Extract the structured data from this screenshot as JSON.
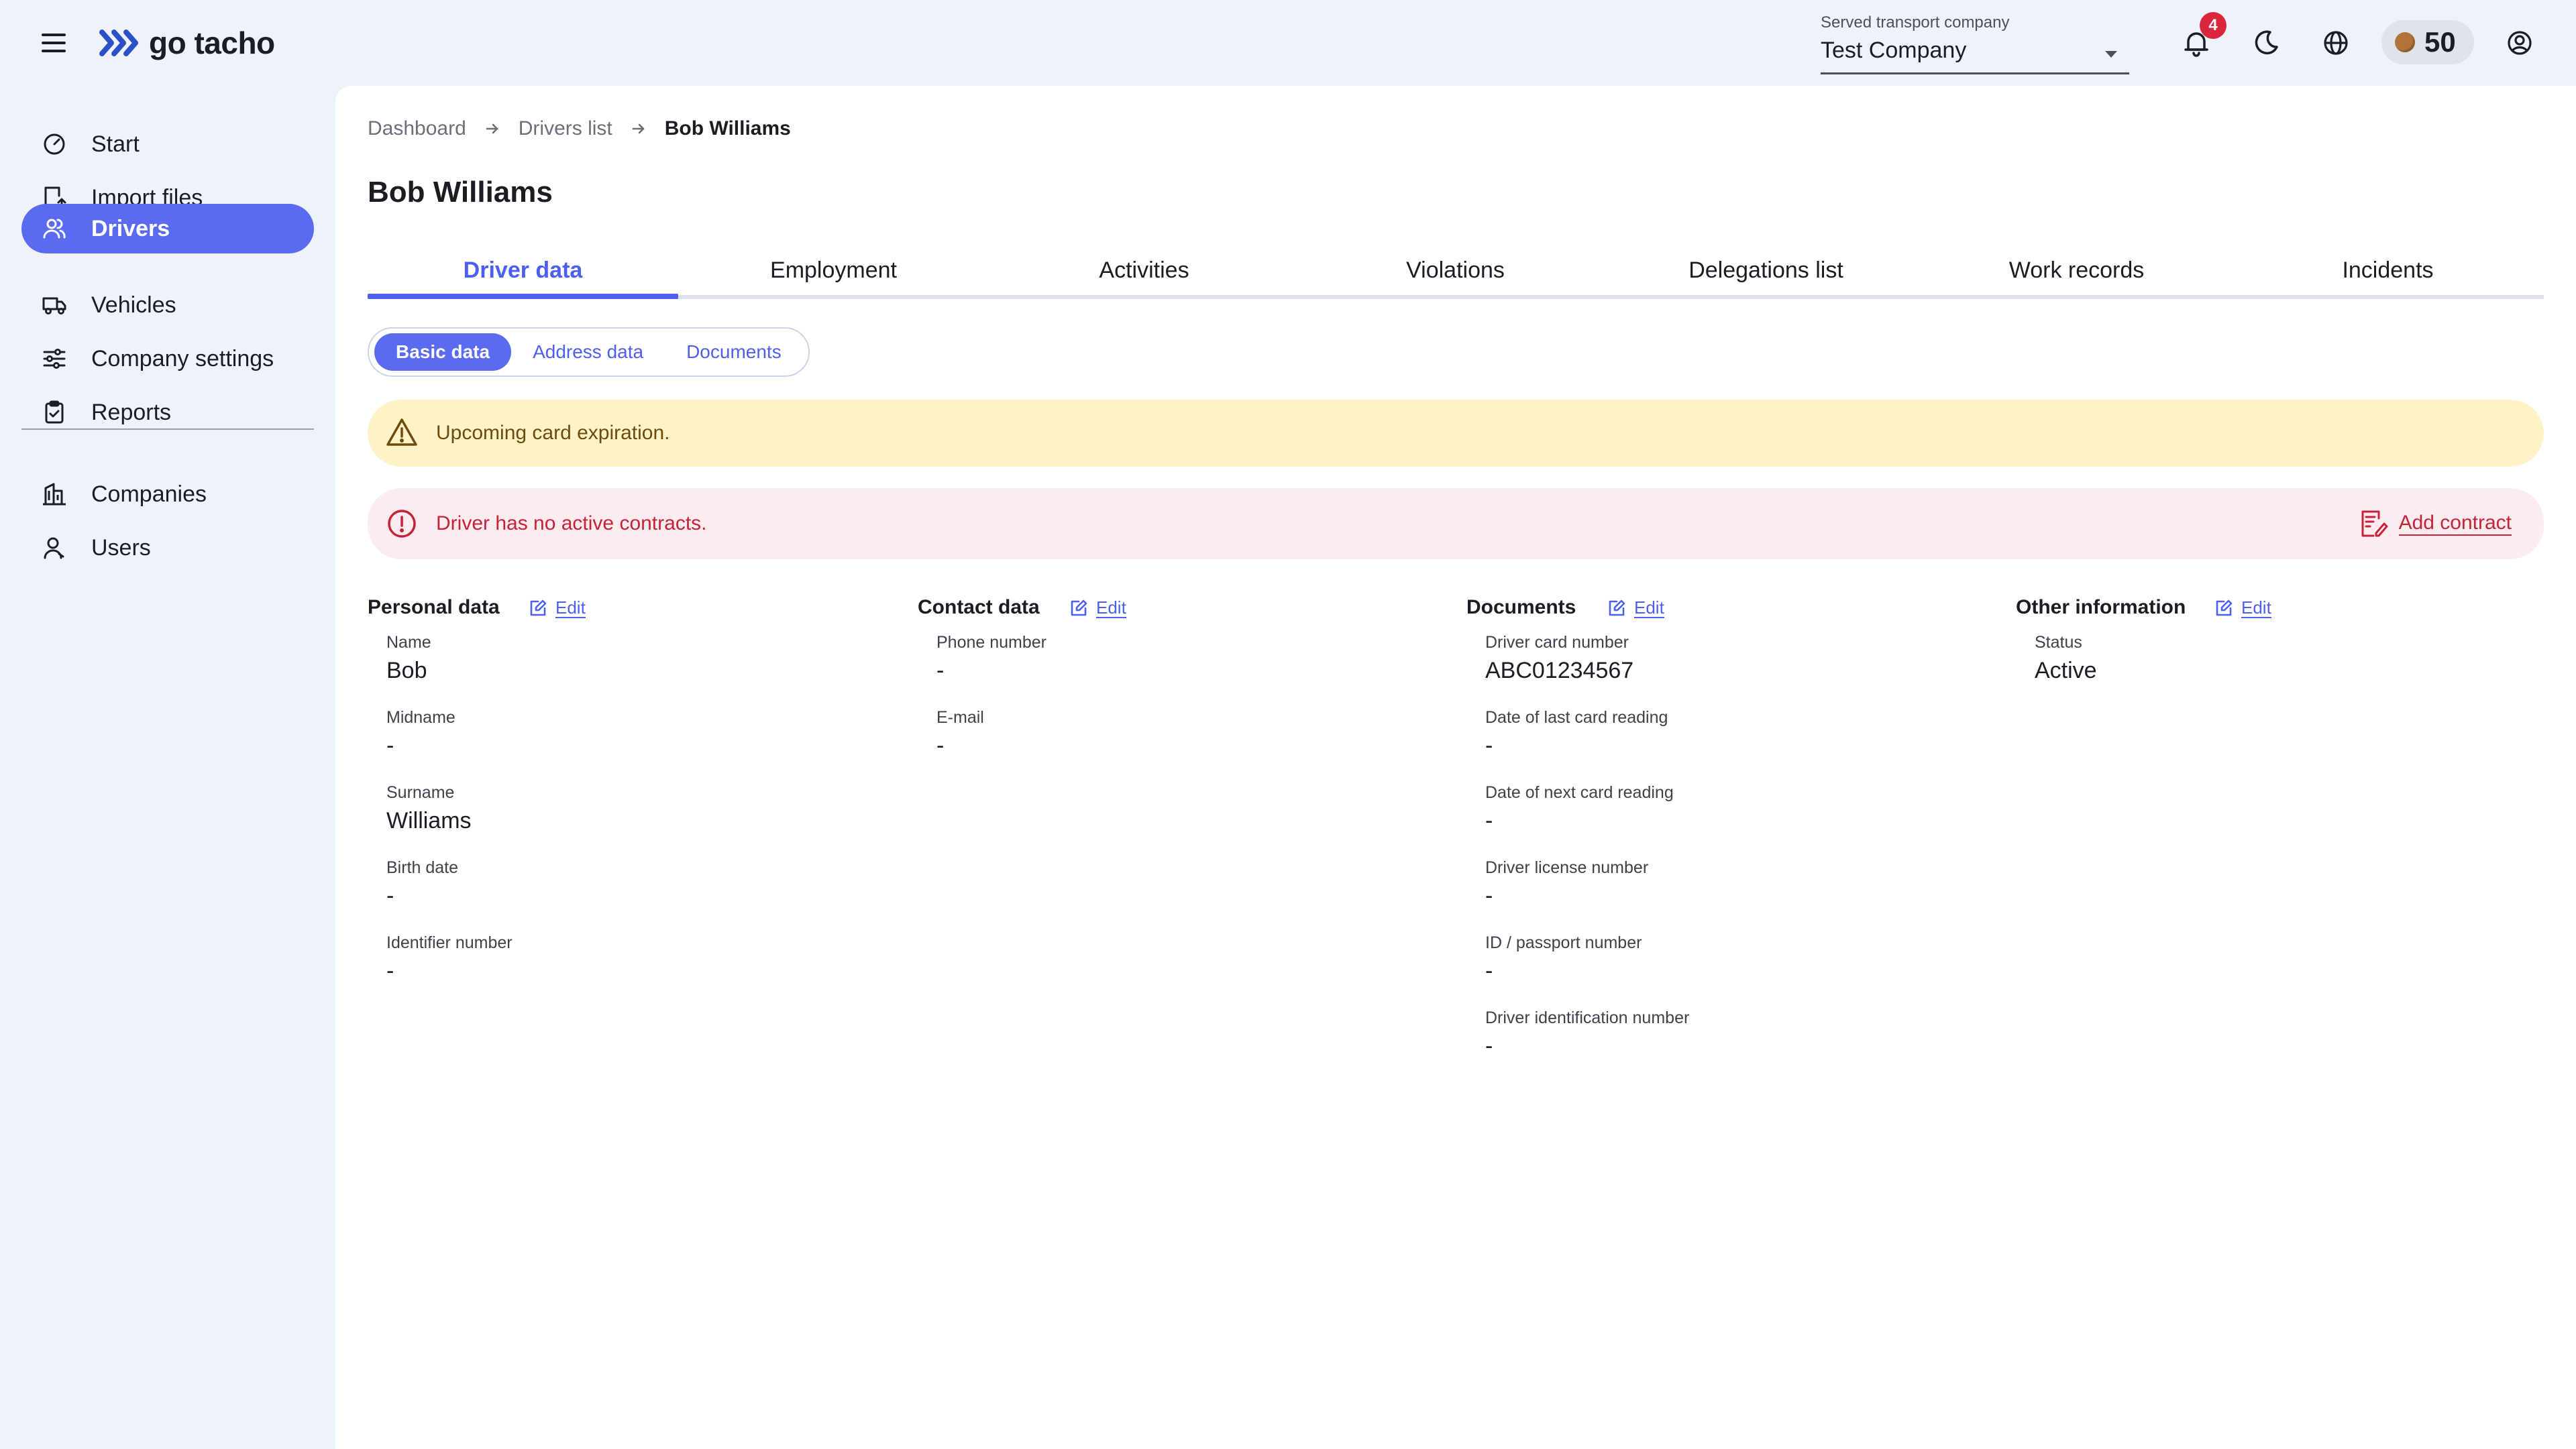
{
  "header": {
    "logo_text": "go tacho",
    "company_label": "Served transport company",
    "company_value": "Test Company",
    "notifications_count": "4",
    "coins": "50"
  },
  "sidebar": {
    "items": [
      {
        "label": "Start",
        "icon": "speedometer-icon"
      },
      {
        "label": "Import files",
        "icon": "import-file-icon"
      },
      {
        "label": "Drivers",
        "icon": "drivers-icon",
        "active": true
      },
      {
        "label": "Vehicles",
        "icon": "truck-icon"
      },
      {
        "label": "Company settings",
        "icon": "sliders-icon"
      },
      {
        "label": "Reports",
        "icon": "clipboard-icon"
      },
      {
        "label": "Companies",
        "icon": "building-icon"
      },
      {
        "label": "Users",
        "icon": "user-icon"
      }
    ]
  },
  "breadcrumb": [
    "Dashboard",
    "Drivers list",
    "Bob Williams"
  ],
  "page_title": "Bob Williams",
  "tabs": [
    "Driver data",
    "Employment",
    "Activities",
    "Violations",
    "Delegations list",
    "Work records",
    "Incidents"
  ],
  "subtabs": [
    "Basic data",
    "Address data",
    "Documents"
  ],
  "alerts": {
    "warning": "Upcoming card expiration.",
    "error": "Driver has no active contracts.",
    "add_contract": "Add contract"
  },
  "edit_label": "Edit",
  "sections": {
    "personal": {
      "title": "Personal data",
      "fields": [
        {
          "label": "Name",
          "value": "Bob"
        },
        {
          "label": "Midname",
          "value": "-"
        },
        {
          "label": "Surname",
          "value": "Williams"
        },
        {
          "label": "Birth date",
          "value": "-"
        },
        {
          "label": "Identifier number",
          "value": "-"
        }
      ]
    },
    "contact": {
      "title": "Contact data",
      "fields": [
        {
          "label": "Phone number",
          "value": "-"
        },
        {
          "label": "E-mail",
          "value": "-"
        }
      ]
    },
    "documents": {
      "title": "Documents",
      "fields": [
        {
          "label": "Driver card number",
          "value": "ABC01234567"
        },
        {
          "label": "Date of last card reading",
          "value": "-"
        },
        {
          "label": "Date of next card reading",
          "value": "-"
        },
        {
          "label": "Driver license number",
          "value": "-"
        },
        {
          "label": "ID / passport number",
          "value": "-"
        },
        {
          "label": "Driver identification number",
          "value": "-"
        }
      ]
    },
    "other": {
      "title": "Other information",
      "fields": [
        {
          "label": "Status",
          "value": "Active"
        }
      ]
    }
  },
  "colors": {
    "accent": "#5b6bf0",
    "warning_bg": "#fdf3c7",
    "error_bg": "#fdecef",
    "error_text": "#c6223a"
  }
}
